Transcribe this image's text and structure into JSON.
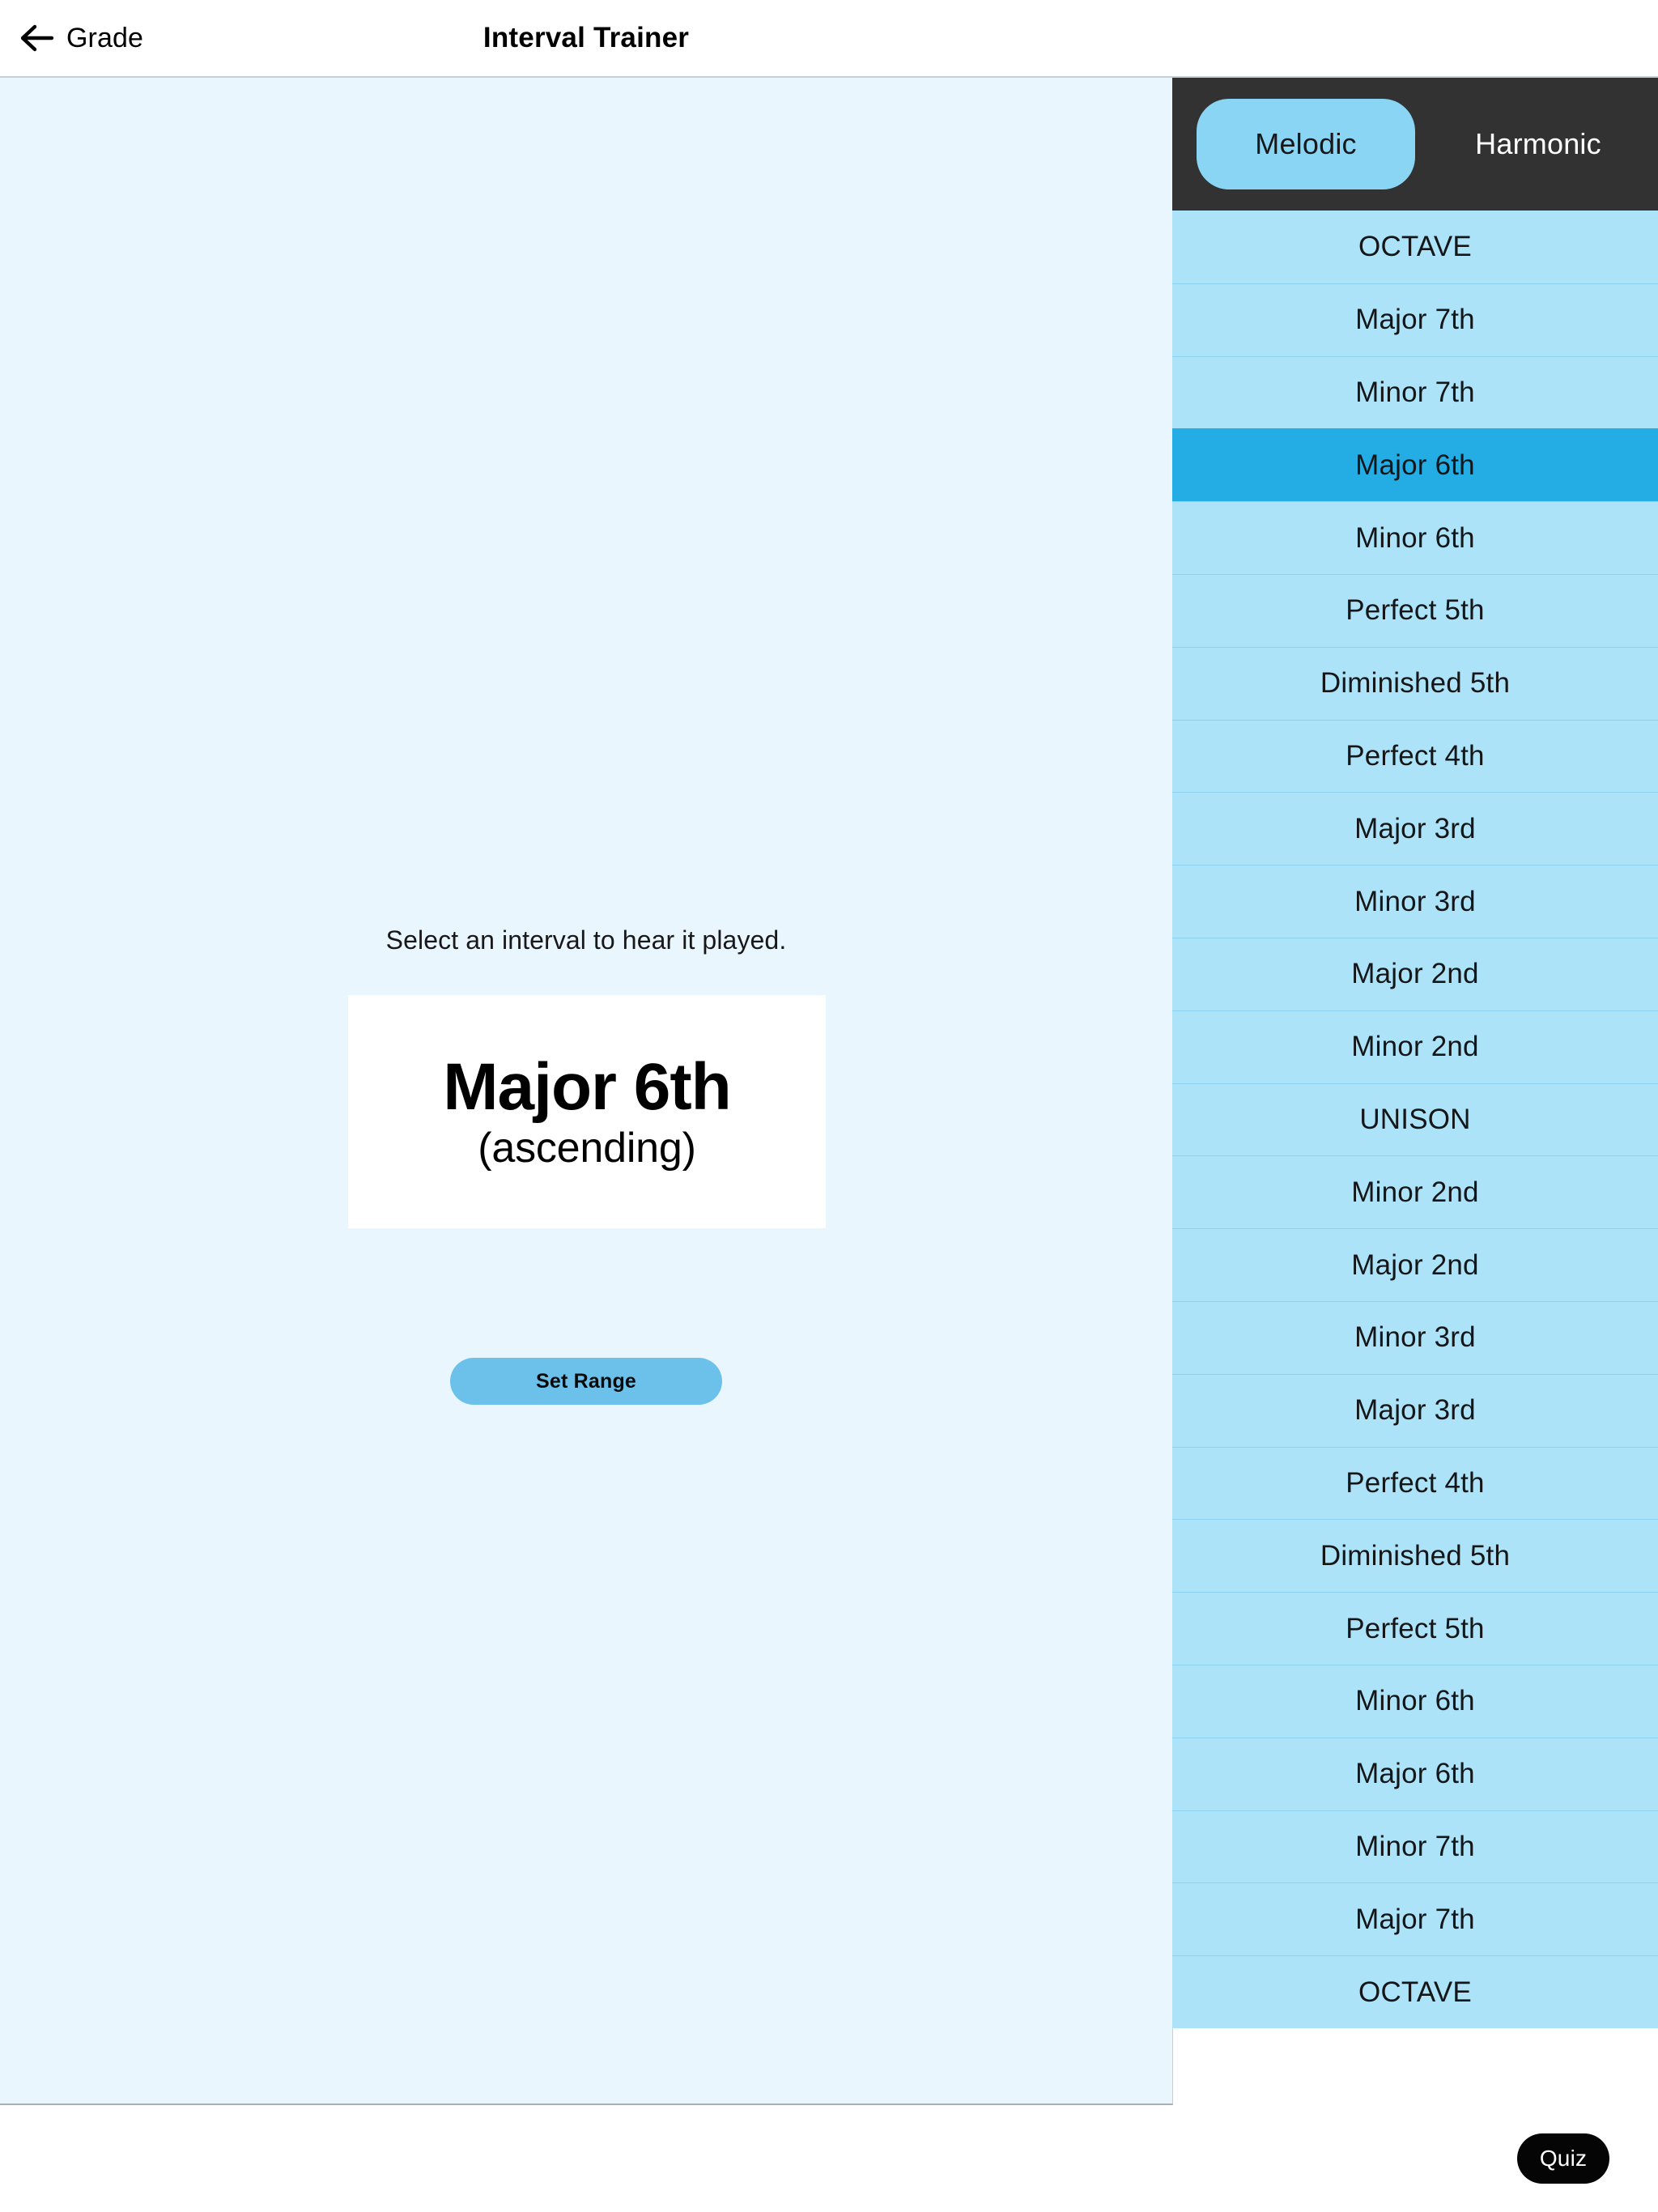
{
  "navbar": {
    "back_label": "Grade",
    "back_icon": "arrow-left-icon",
    "title": "Interval Trainer"
  },
  "main": {
    "prompt": "Select an interval to hear it played.",
    "card": {
      "interval_name": "Major 6th",
      "direction": "(ascending)"
    },
    "set_range_label": "Set Range"
  },
  "sidebar": {
    "mode_toggle": {
      "options": [
        "Melodic",
        "Harmonic"
      ],
      "selected": "Melodic"
    },
    "selected_interval_index": 3,
    "intervals": [
      "OCTAVE",
      "Major 7th",
      "Minor 7th",
      "Major 6th",
      "Minor 6th",
      "Perfect 5th",
      "Diminished 5th",
      "Perfect 4th",
      "Major 3rd",
      "Minor 3rd",
      "Major 2nd",
      "Minor 2nd",
      "UNISON",
      "Minor 2nd",
      "Major 2nd",
      "Minor 3rd",
      "Major 3rd",
      "Perfect 4th",
      "Diminished 5th",
      "Perfect 5th",
      "Minor 6th",
      "Major 6th",
      "Minor 7th",
      "Major 7th",
      "OCTAVE"
    ]
  },
  "footer": {
    "quiz_label": "Quiz"
  },
  "colors": {
    "accent_light": "#ade3f9",
    "accent_selected": "#24ace5",
    "toggle_active": "#8ad5f4",
    "toolbar_dark": "#333233",
    "content_bg": "#eaf6fe",
    "button_blue": "#6cc1ea",
    "quiz_black": "#050505"
  }
}
